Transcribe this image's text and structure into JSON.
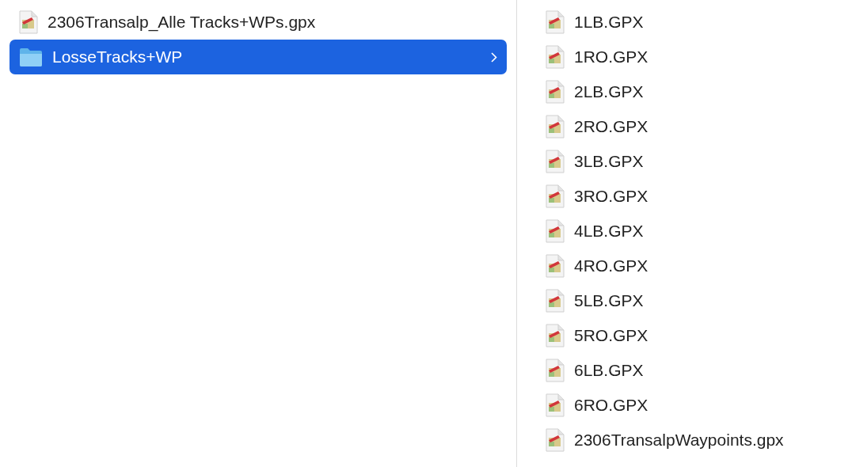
{
  "columns": [
    {
      "items": [
        {
          "name": "2306Transalp_Alle Tracks+WPs.gpx",
          "kind": "file",
          "selected": false
        },
        {
          "name": "LosseTracks+WP",
          "kind": "folder",
          "selected": true
        }
      ]
    },
    {
      "items": [
        {
          "name": "1LB.GPX",
          "kind": "file",
          "selected": false
        },
        {
          "name": "1RO.GPX",
          "kind": "file",
          "selected": false
        },
        {
          "name": "2LB.GPX",
          "kind": "file",
          "selected": false
        },
        {
          "name": "2RO.GPX",
          "kind": "file",
          "selected": false
        },
        {
          "name": "3LB.GPX",
          "kind": "file",
          "selected": false
        },
        {
          "name": "3RO.GPX",
          "kind": "file",
          "selected": false
        },
        {
          "name": "4LB.GPX",
          "kind": "file",
          "selected": false
        },
        {
          "name": "4RO.GPX",
          "kind": "file",
          "selected": false
        },
        {
          "name": "5LB.GPX",
          "kind": "file",
          "selected": false
        },
        {
          "name": "5RO.GPX",
          "kind": "file",
          "selected": false
        },
        {
          "name": "6LB.GPX",
          "kind": "file",
          "selected": false
        },
        {
          "name": "6RO.GPX",
          "kind": "file",
          "selected": false
        },
        {
          "name": "2306TransalpWaypoints.gpx",
          "kind": "file",
          "selected": false
        }
      ]
    }
  ]
}
